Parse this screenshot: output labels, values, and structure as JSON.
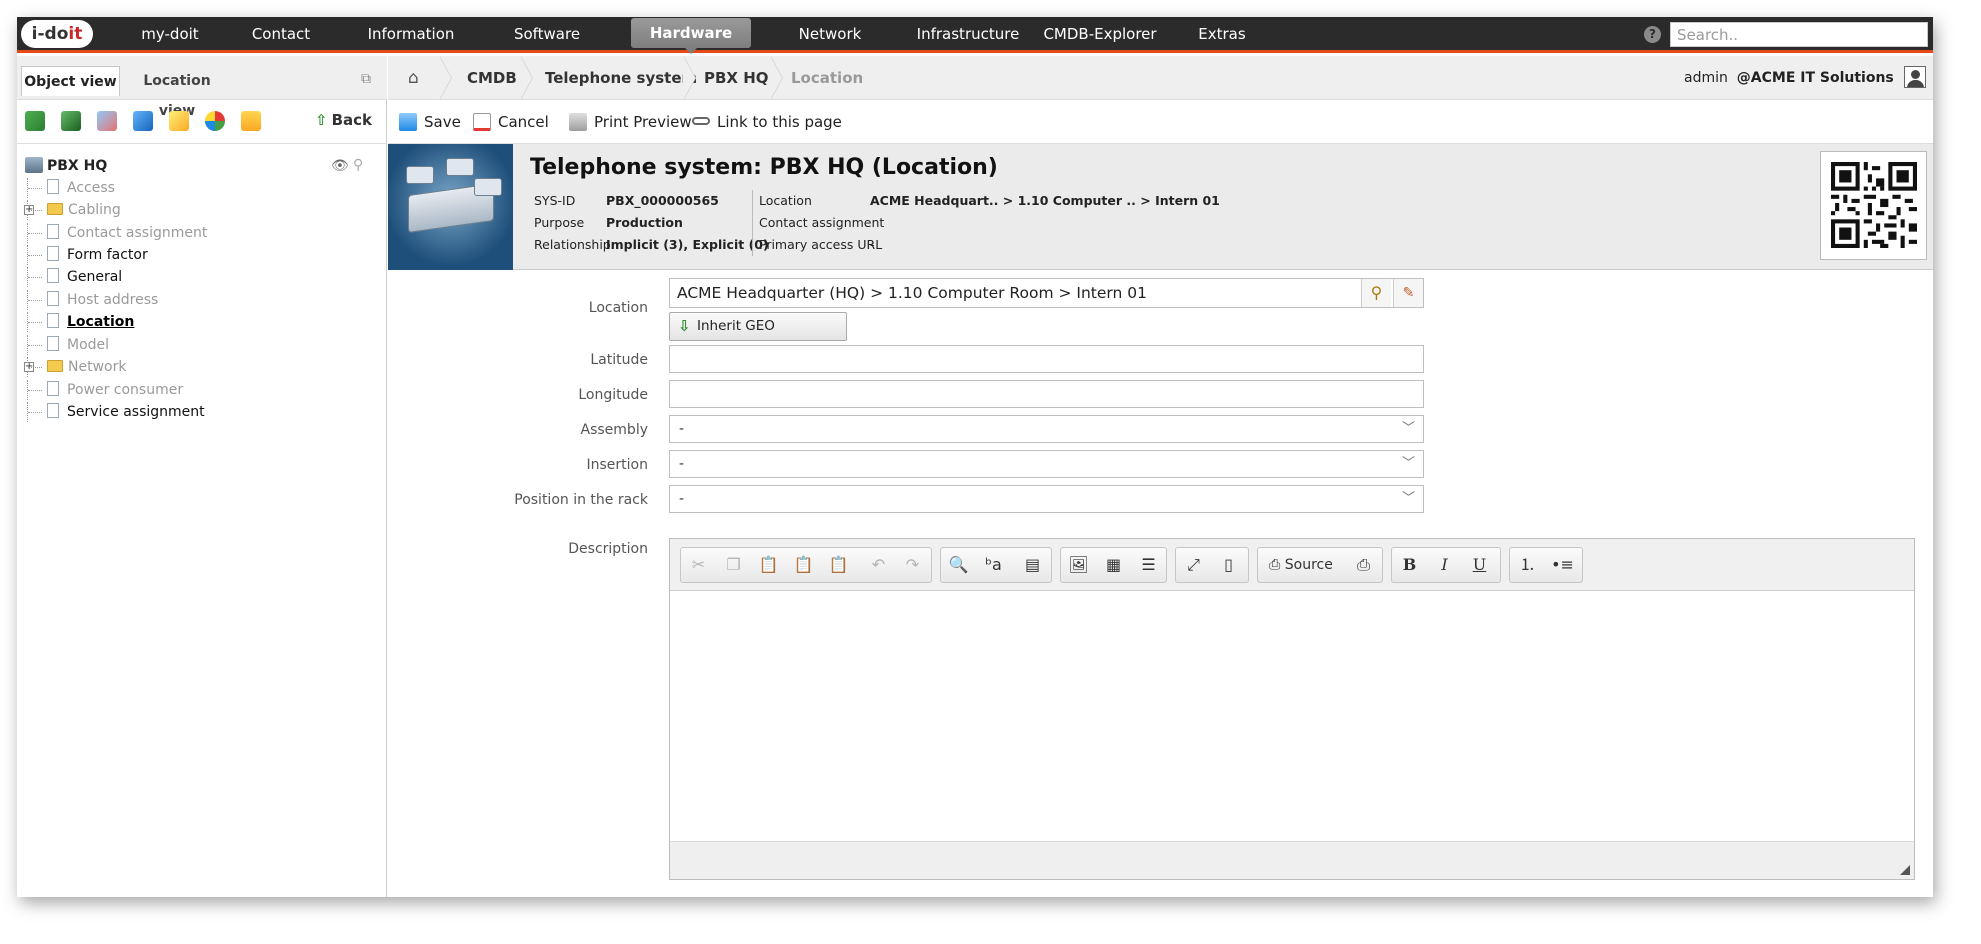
{
  "topnav": {
    "logo": {
      "prefix": "i-do",
      "suffix": "it"
    },
    "items": [
      "my-doit",
      "Contact",
      "Information",
      "Software",
      "Hardware",
      "Network",
      "Infrastructure",
      "CMDB-Explorer",
      "Extras"
    ],
    "active": "Hardware",
    "help_icon": "question-circle-icon",
    "search_placeholder": "Search.."
  },
  "left": {
    "tabs": {
      "object_view": "Object view",
      "location_view": "Location view"
    },
    "back_label": "Back",
    "tree": {
      "root": "PBX HQ",
      "nodes": [
        {
          "label": "Access",
          "type": "doc",
          "state": "grey"
        },
        {
          "label": "Cabling",
          "type": "folder",
          "state": "grey"
        },
        {
          "label": "Contact assignment",
          "type": "doc",
          "state": "grey"
        },
        {
          "label": "Form factor",
          "type": "doc",
          "state": "dark"
        },
        {
          "label": "General",
          "type": "doc",
          "state": "dark"
        },
        {
          "label": "Host address",
          "type": "doc",
          "state": "grey"
        },
        {
          "label": "Location",
          "type": "doc",
          "state": "bold"
        },
        {
          "label": "Model",
          "type": "doc",
          "state": "grey"
        },
        {
          "label": "Network",
          "type": "folder",
          "state": "grey"
        },
        {
          "label": "Power consumer",
          "type": "doc",
          "state": "grey"
        },
        {
          "label": "Service assignment",
          "type": "doc",
          "state": "dark"
        }
      ]
    }
  },
  "breadcrumb": [
    "CMDB",
    "Telephone system",
    "PBX HQ",
    "Location"
  ],
  "user": {
    "name": "admin",
    "tenant": "@ACME IT Solutions"
  },
  "actions": {
    "save": "Save",
    "cancel": "Cancel",
    "print_preview": "Print Preview",
    "link": "Link to this page"
  },
  "object": {
    "title": "Telephone system: PBX HQ (Location)",
    "info": {
      "sysid_label": "SYS-ID",
      "sysid": "PBX_000000565",
      "purpose_label": "Purpose",
      "purpose": "Production",
      "relationship_label": "Relationship",
      "relationship": "Implicit (3), Explicit (0)",
      "location_label": "Location",
      "location": "ACME Headquart.. > 1.10 Computer .. > Intern 01",
      "contact_label": "Contact assignment",
      "contact": "",
      "url_label": "Primary access URL",
      "url": "-"
    }
  },
  "form": {
    "location_label": "Location",
    "location_value": "ACME Headquarter (HQ) > 1.10 Computer Room > Intern 01",
    "inherit_geo": "Inherit GEO coordinates",
    "latitude_label": "Latitude",
    "latitude": "",
    "longitude_label": "Longitude",
    "longitude": "",
    "assembly_label": "Assembly",
    "assembly": "-",
    "insertion_label": "Insertion",
    "insertion": "-",
    "rack_label": "Position in the rack",
    "rack": "-",
    "description_label": "Description",
    "source_label": "Source"
  },
  "colors": {
    "nav_bg": "#2b2b2b",
    "nav_accent": "#e64a19",
    "active_tab": "#8a8a8a",
    "link_blue": "#1a56a8"
  }
}
